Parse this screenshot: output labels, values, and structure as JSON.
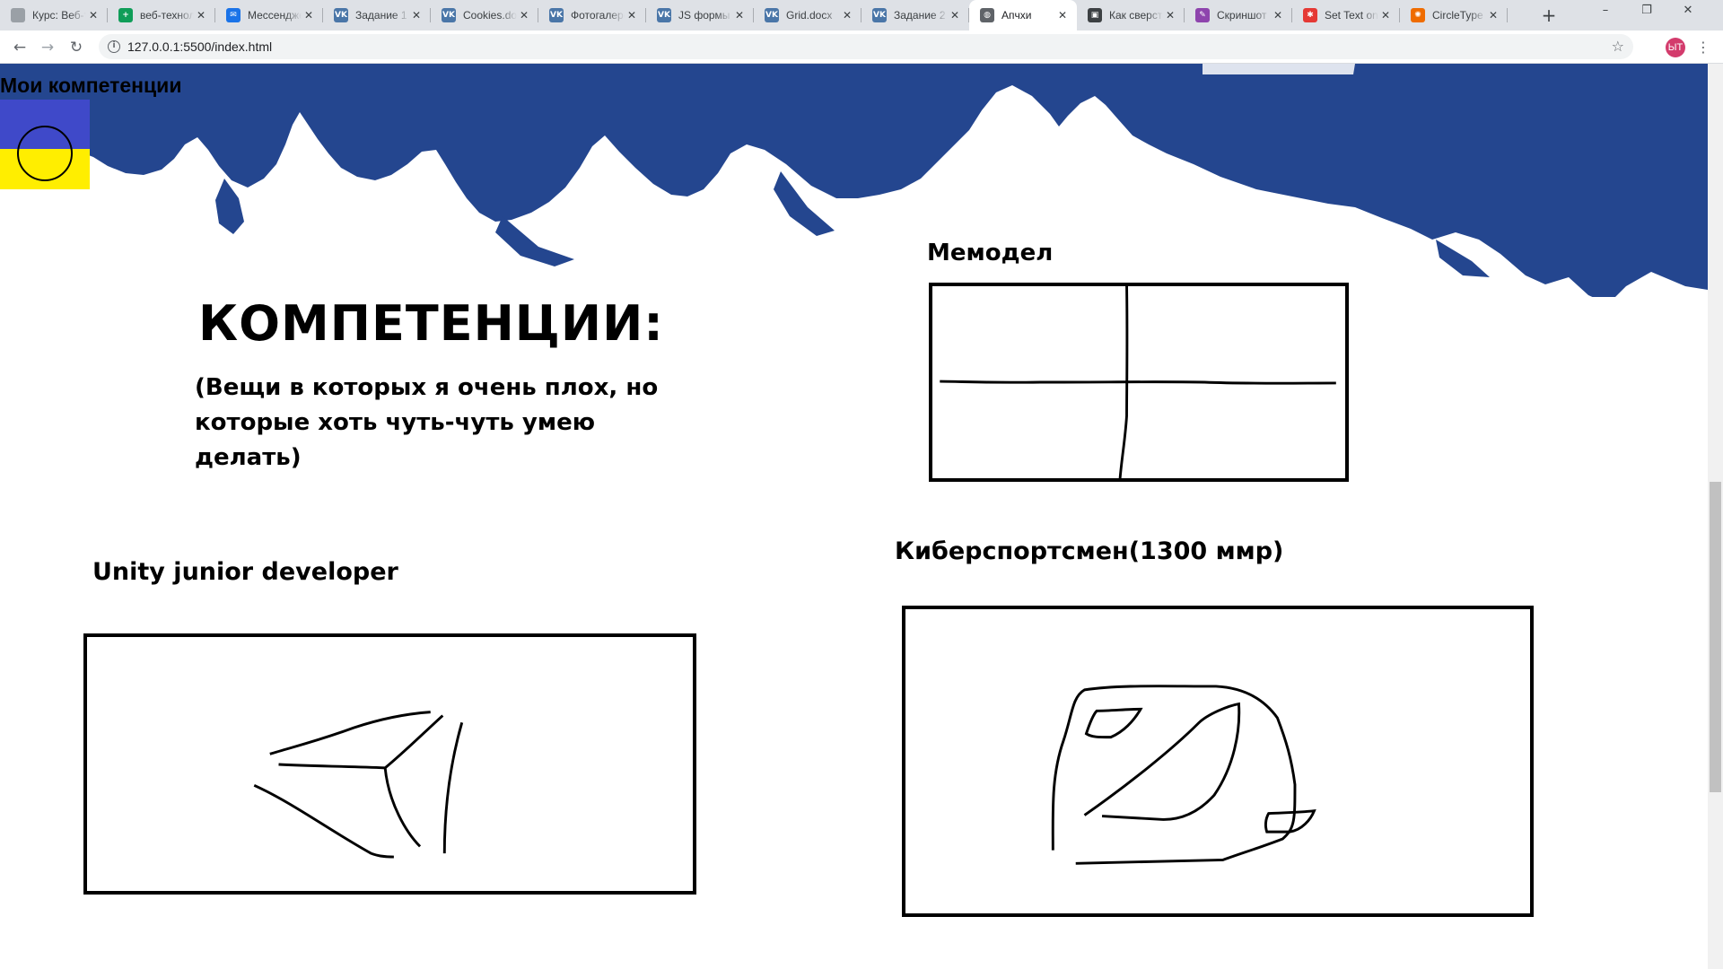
{
  "browser": {
    "tabs": [
      {
        "title": "Курс: Веб-технологии",
        "icon": "globe-icon",
        "icon_color": "#9aa0a6",
        "icon_text": ""
      },
      {
        "title": "веб-технологии",
        "icon": "sheets-icon",
        "icon_color": "#0f9d58",
        "icon_text": "+"
      },
      {
        "title": "Мессенджер",
        "icon": "messenger-icon",
        "icon_color": "#1a73e8",
        "icon_text": "✉"
      },
      {
        "title": "Задание 1",
        "icon": "vk-icon",
        "icon_color": "#4a76a8",
        "icon_text": "VK"
      },
      {
        "title": "Cookies.docx",
        "icon": "vk-icon",
        "icon_color": "#4a76a8",
        "icon_text": "VK"
      },
      {
        "title": "Фотогалерея",
        "icon": "vk-icon",
        "icon_color": "#4a76a8",
        "icon_text": "VK"
      },
      {
        "title": "JS формы",
        "icon": "vk-icon",
        "icon_color": "#4a76a8",
        "icon_text": "VK"
      },
      {
        "title": "Grid.docx",
        "icon": "vk-icon",
        "icon_color": "#4a76a8",
        "icon_text": "VK"
      },
      {
        "title": "Задание 2",
        "icon": "vk-icon",
        "icon_color": "#4a76a8",
        "icon_text": "VK"
      },
      {
        "title": "Апчхи",
        "icon": "globe-icon",
        "icon_color": "#5f6368",
        "icon_text": "◍",
        "active": true
      },
      {
        "title": "Как сверстать",
        "icon": "page-icon",
        "icon_color": "#3c4043",
        "icon_text": "▣"
      },
      {
        "title": "Скриншот",
        "icon": "pen-icon",
        "icon_color": "#8e44ad",
        "icon_text": "✎"
      },
      {
        "title": "Set Text on",
        "icon": "star-burst-icon",
        "icon_color": "#e53935",
        "icon_text": "✱"
      },
      {
        "title": "CircleType",
        "icon": "circle-dots-icon",
        "icon_color": "#ef6c00",
        "icon_text": "✺"
      }
    ],
    "new_tab": "+",
    "window_controls": {
      "minimize": "–",
      "restore": "❐",
      "close": "✕"
    },
    "nav": {
      "back": "←",
      "forward": "→",
      "reload": "↻"
    },
    "url": "127.0.0.1:5500/index.html",
    "info": "i",
    "star": "☆",
    "profile_initials": "ЫТ",
    "menu": "⋮"
  },
  "page": {
    "site_title": "Мои компетенции",
    "competences_title": "КОМПЕТЕНЦИИ:",
    "competences_subtitle": "(Вещи в которых я очень плох, но которые хоть чуть-чуть умею делать)",
    "memodel_title": "Мемодел",
    "unity_title": "Unity junior developer",
    "esport_title": "Киберспортсмен(1300 ммр)"
  },
  "colors": {
    "ink_blue": "#24468f",
    "flag_blue": "#3f49c9",
    "flag_yellow": "#ffee00"
  }
}
